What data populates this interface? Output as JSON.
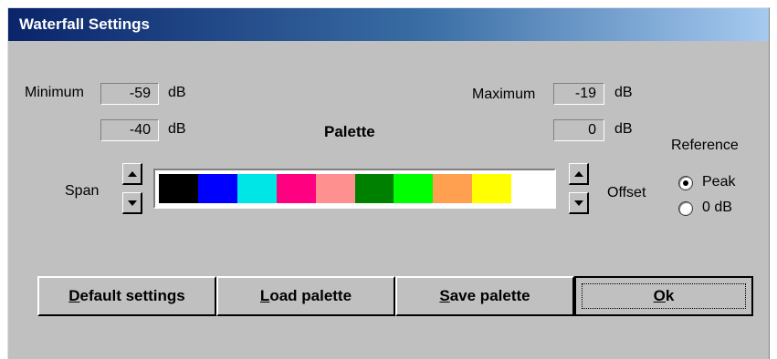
{
  "window": {
    "title": "Waterfall Settings"
  },
  "minimum": {
    "label": "Minimum",
    "value": "-59",
    "unit": "dB"
  },
  "span_value": {
    "value": "-40",
    "unit": "dB"
  },
  "maximum": {
    "label": "Maximum",
    "value": "-19",
    "unit": "dB"
  },
  "offset_value": {
    "value": "0",
    "unit": "dB"
  },
  "palette": {
    "label": "Palette",
    "colors": [
      "#000000",
      "#0000ff",
      "#00e5e5",
      "#ff0080",
      "#ff9090",
      "#008000",
      "#00ff00",
      "#ffa050",
      "#ffff00",
      "#ffffff"
    ]
  },
  "span": {
    "label": "Span"
  },
  "offset": {
    "label": "Offset"
  },
  "reference": {
    "label": "Reference",
    "options": [
      "Peak",
      "0 dB"
    ],
    "selected": "Peak"
  },
  "buttons": {
    "default_settings": {
      "mnemonic": "D",
      "rest": "efault settings"
    },
    "load_palette": {
      "mnemonic": "L",
      "rest": "oad palette"
    },
    "save_palette": {
      "mnemonic": "S",
      "rest": "ave palette"
    },
    "ok": {
      "mnemonic": "O",
      "rest": "k"
    }
  }
}
